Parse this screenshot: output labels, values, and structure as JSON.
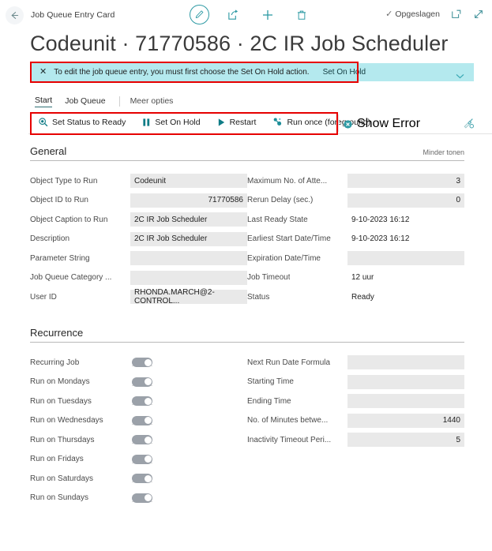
{
  "header": {
    "back_icon": "back-arrow-icon",
    "breadcrumb": "Job Queue Entry Card",
    "edit_icon": "pencil-icon",
    "share_icon": "share-icon",
    "new_icon": "plus-icon",
    "delete_icon": "trash-icon",
    "saved_label": "Opgeslagen",
    "saved_check": "✓",
    "popout_icon": "open-in-new-window-icon",
    "expand_icon": "expand-icon"
  },
  "page_title": "Codeunit · 71770586 · 2C IR Job Scheduler",
  "notification": {
    "close_icon": "close-icon",
    "message": "To edit the job queue entry, you must first choose the Set On Hold action.",
    "action_label": "Set On Hold",
    "chevron_icon": "chevron-down-icon"
  },
  "tabs": [
    {
      "label": "Start",
      "active": true
    },
    {
      "label": "Job Queue",
      "active": false
    },
    {
      "label": "Meer opties",
      "active": false
    }
  ],
  "actions": [
    {
      "label": "Set Status to Ready",
      "icon": "status-ready-icon"
    },
    {
      "label": "Set On Hold",
      "icon": "pause-icon"
    },
    {
      "label": "Restart",
      "icon": "play-icon"
    },
    {
      "label": "Run once (foreground)",
      "icon": "run-once-icon"
    }
  ],
  "action_right": {
    "label": "Show Error",
    "icon": "error-circle-icon"
  },
  "action_far_icon": "personalize-icon",
  "sections": [
    {
      "title": "General",
      "toggle_link": "Minder tonen",
      "left_fields": [
        {
          "label": "Object Type to Run",
          "value": "Codeunit",
          "align": "left"
        },
        {
          "label": "Object ID to Run",
          "value": "71770586",
          "align": "right"
        },
        {
          "label": "Object Caption to Run",
          "value": "2C IR Job Scheduler",
          "align": "left"
        },
        {
          "label": "Description",
          "value": "2C IR Job Scheduler",
          "align": "left"
        },
        {
          "label": "Parameter String",
          "value": "",
          "align": "left"
        },
        {
          "label": "Job Queue Category ...",
          "value": "",
          "align": "left"
        },
        {
          "label": "User ID",
          "value": "RHONDA.MARCH@2-CONTROL...",
          "align": "left"
        }
      ],
      "right_fields": [
        {
          "label": "Maximum No. of Atte...",
          "value": "3",
          "align": "right"
        },
        {
          "label": "Rerun Delay (sec.)",
          "value": "0",
          "align": "right"
        },
        {
          "label": "Last Ready State",
          "value": "9-10-2023 16:12",
          "align": "left",
          "plain": true
        },
        {
          "label": "Earliest Start Date/Time",
          "value": "9-10-2023 16:12",
          "align": "left",
          "plain": true
        },
        {
          "label": "Expiration Date/Time",
          "value": "",
          "align": "left"
        },
        {
          "label": "Job Timeout",
          "value": "12 uur",
          "align": "left",
          "plain": true
        },
        {
          "label": "Status",
          "value": "Ready",
          "align": "left",
          "plain": true
        }
      ]
    },
    {
      "title": "Recurrence",
      "toggle_link": "",
      "left_toggles": [
        {
          "label": "Recurring Job",
          "on": true
        },
        {
          "label": "Run on Mondays",
          "on": true
        },
        {
          "label": "Run on Tuesdays",
          "on": true
        },
        {
          "label": "Run on Wednesdays",
          "on": true
        },
        {
          "label": "Run on Thursdays",
          "on": true
        },
        {
          "label": "Run on Fridays",
          "on": true
        },
        {
          "label": "Run on Saturdays",
          "on": true
        },
        {
          "label": "Run on Sundays",
          "on": true
        }
      ],
      "right_fields": [
        {
          "label": "Next Run Date Formula",
          "value": "",
          "align": "left"
        },
        {
          "label": "Starting Time",
          "value": "",
          "align": "left"
        },
        {
          "label": "Ending Time",
          "value": "",
          "align": "left"
        },
        {
          "label": "No. of Minutes betwe...",
          "value": "1440",
          "align": "right"
        },
        {
          "label": "Inactivity Timeout Peri...",
          "value": "5",
          "align": "right"
        }
      ]
    }
  ],
  "colors": {
    "accent_teal": "#2e9aa4",
    "notification_bg": "#b4e9ee",
    "highlight_red": "#e60000",
    "field_bg": "#e9e9e9",
    "toggle_on": "#9ba1a9"
  }
}
